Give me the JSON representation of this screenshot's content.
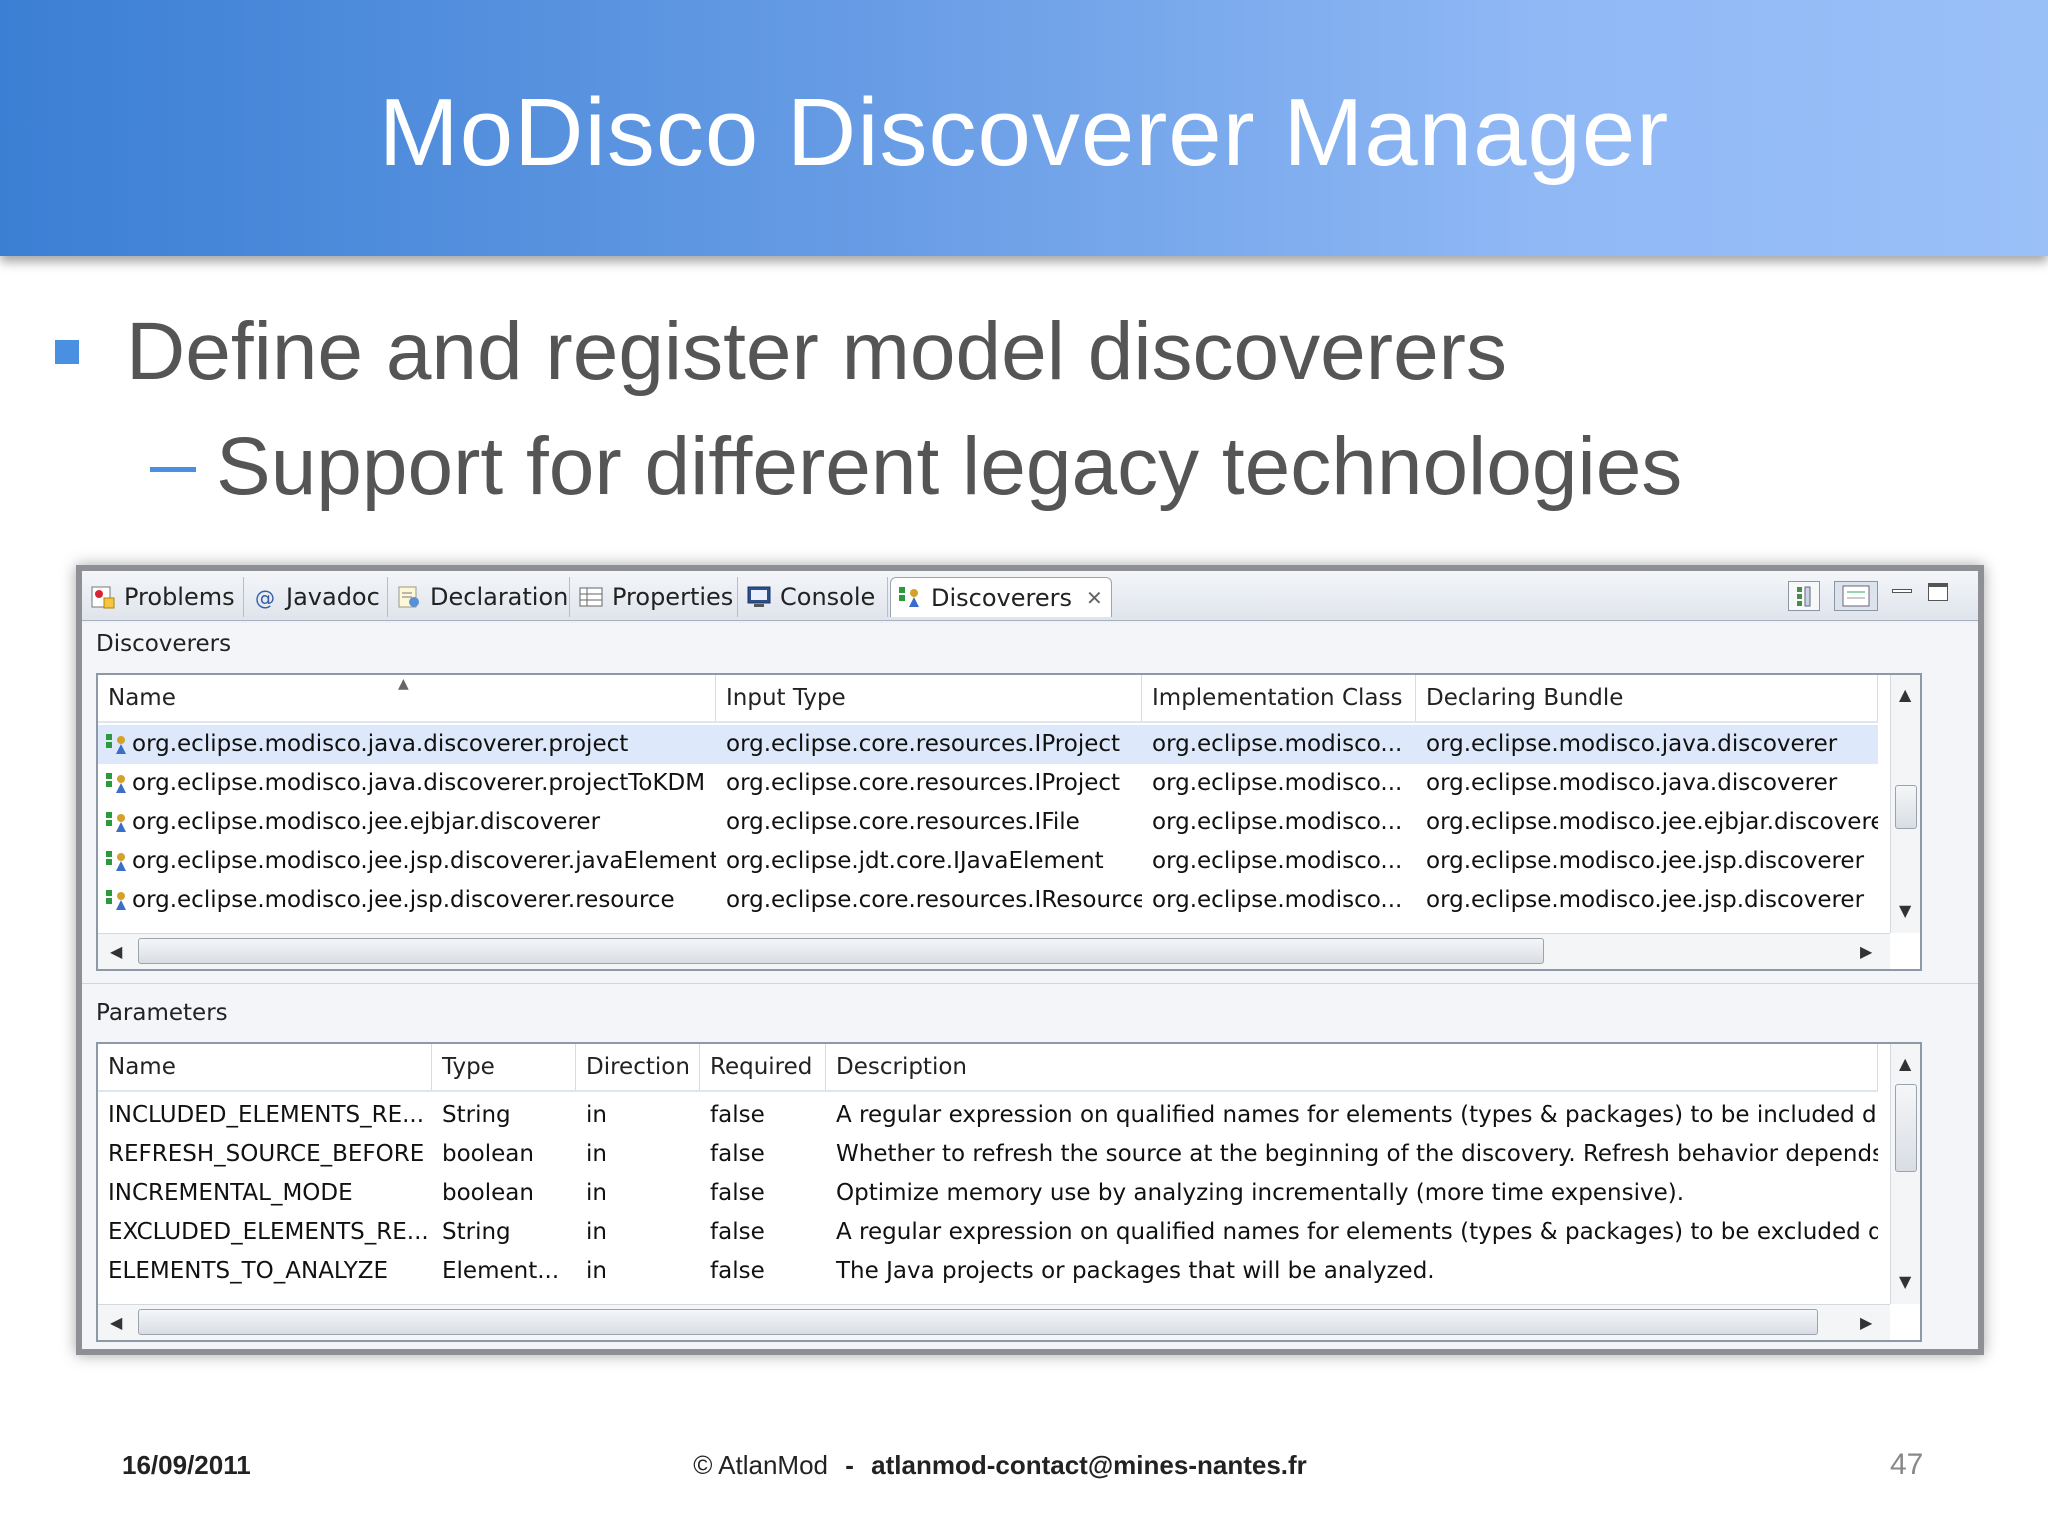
{
  "slide": {
    "title": "MoDisco Discoverer Manager",
    "bullet1": "Define and register model discoverers",
    "bullet2": "Support for different legacy technologies"
  },
  "view_tabs": [
    {
      "label": "Problems",
      "icon": "problems-icon"
    },
    {
      "label": "Javadoc",
      "icon": "javadoc-icon"
    },
    {
      "label": "Declaration",
      "icon": "declaration-icon"
    },
    {
      "label": "Properties",
      "icon": "properties-icon"
    },
    {
      "label": "Console",
      "icon": "console-icon"
    },
    {
      "label": "Discoverers",
      "icon": "discoverers-icon",
      "active": true,
      "close": "✕"
    }
  ],
  "discoverers": {
    "label": "Discoverers",
    "columns": [
      "Name",
      "Input Type",
      "Implementation Class",
      "Declaring Bundle"
    ],
    "rows": [
      [
        "org.eclipse.modisco.java.discoverer.project",
        "org.eclipse.core.resources.IProject",
        "org.eclipse.modisco...",
        "org.eclipse.modisco.java.discoverer"
      ],
      [
        "org.eclipse.modisco.java.discoverer.projectToKDM",
        "org.eclipse.core.resources.IProject",
        "org.eclipse.modisco...",
        "org.eclipse.modisco.java.discoverer"
      ],
      [
        "org.eclipse.modisco.jee.ejbjar.discoverer",
        "org.eclipse.core.resources.IFile",
        "org.eclipse.modisco...",
        "org.eclipse.modisco.jee.ejbjar.discoverer"
      ],
      [
        "org.eclipse.modisco.jee.jsp.discoverer.javaElement",
        "org.eclipse.jdt.core.IJavaElement",
        "org.eclipse.modisco...",
        "org.eclipse.modisco.jee.jsp.discoverer"
      ],
      [
        "org.eclipse.modisco.jee.jsp.discoverer.resource",
        "org.eclipse.core.resources.IResource",
        "org.eclipse.modisco...",
        "org.eclipse.modisco.jee.jsp.discoverer"
      ]
    ]
  },
  "parameters": {
    "label": "Parameters",
    "columns": [
      "Name",
      "Type",
      "Direction",
      "Required",
      "Description"
    ],
    "rows": [
      [
        "INCLUDED_ELEMENTS_RE...",
        "String",
        "in",
        "false",
        "A regular expression on qualified names for elements (types & packages) to be included durin..."
      ],
      [
        "REFRESH_SOURCE_BEFORE",
        "boolean",
        "in",
        "false",
        "Whether to refresh the source at the beginning of the discovery. Refresh behavior depends on..."
      ],
      [
        "INCREMENTAL_MODE",
        "boolean",
        "in",
        "false",
        "Optimize memory use by analyzing incrementally (more time expensive)."
      ],
      [
        "EXCLUDED_ELEMENTS_RE...",
        "String",
        "in",
        "false",
        "A regular expression on qualified names for elements (types & packages) to be excluded duri..."
      ],
      [
        "ELEMENTS_TO_ANALYZE",
        "Element...",
        "in",
        "false",
        "The Java projects or packages that will be analyzed."
      ]
    ]
  },
  "footer": {
    "date": "16/09/2011",
    "copyright": "© AtlanMod",
    "separator": "-",
    "email": "atlanmod-contact@mines-nantes.fr",
    "page": "47"
  },
  "colors": {
    "banner_start": "#3b7fd4",
    "banner_end": "#9bc0f8",
    "bullet": "#4a90e2",
    "selection": "#dde9fa"
  }
}
